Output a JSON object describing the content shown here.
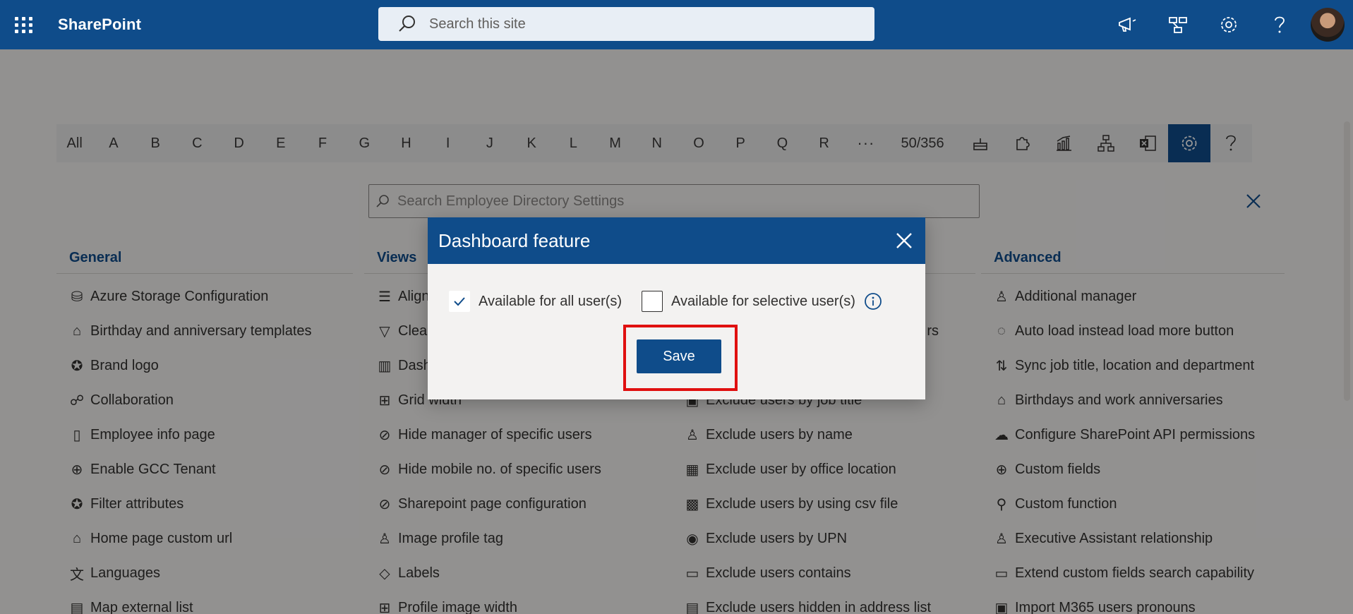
{
  "app": {
    "brand": "SharePoint",
    "search_placeholder": "Search this site"
  },
  "alphabet": {
    "items": [
      "All",
      "A",
      "B",
      "C",
      "D",
      "E",
      "F",
      "G",
      "H",
      "I",
      "J",
      "K",
      "L",
      "M",
      "N",
      "O",
      "P",
      "Q",
      "R"
    ],
    "more": "···",
    "count": "50/356"
  },
  "settings_search": {
    "placeholder": "Search Employee Directory Settings"
  },
  "columns": {
    "general": {
      "title": "General",
      "items": [
        {
          "label": "Azure Storage Configuration",
          "icon": "database-icon"
        },
        {
          "label": "Birthday and anniversary templates",
          "icon": "cake-icon"
        },
        {
          "label": "Brand logo",
          "icon": "badge-icon"
        },
        {
          "label": "Collaboration",
          "icon": "handshake-icon"
        },
        {
          "label": "Employee info page",
          "icon": "page-search-icon"
        },
        {
          "label": "Enable GCC Tenant",
          "icon": "globe-icon"
        },
        {
          "label": "Filter attributes",
          "icon": "badge-icon"
        },
        {
          "label": "Home page custom url",
          "icon": "home-icon"
        },
        {
          "label": "Languages",
          "icon": "language-icon"
        },
        {
          "label": "Map external list",
          "icon": "list-icon"
        }
      ]
    },
    "views": {
      "title": "Views",
      "items": [
        {
          "label": "Align",
          "icon": "align-icon"
        },
        {
          "label": "Clear",
          "icon": "filter-icon"
        },
        {
          "label": "Dash",
          "icon": "chart-icon"
        },
        {
          "label": "Grid width",
          "icon": "grid-icon"
        },
        {
          "label": "Hide manager of specific users",
          "icon": "hide-icon"
        },
        {
          "label": "Hide mobile no. of specific users",
          "icon": "hide-icon"
        },
        {
          "label": "Sharepoint page configuration",
          "icon": "hide-icon"
        },
        {
          "label": "Image profile tag",
          "icon": "person-icon"
        },
        {
          "label": "Labels",
          "icon": "tag-icon"
        },
        {
          "label": "Profile image width",
          "icon": "grid-icon"
        }
      ]
    },
    "exclude": {
      "items": [
        {
          "label": "",
          "icon": ""
        },
        {
          "label": "rs",
          "icon": ""
        },
        {
          "label": "",
          "icon": ""
        },
        {
          "label": "Exclude users by job title",
          "icon": "briefcase-icon"
        },
        {
          "label": "Exclude users by name",
          "icon": "person-search-icon"
        },
        {
          "label": "Exclude user by office location",
          "icon": "building-icon"
        },
        {
          "label": "Exclude users by using csv file",
          "icon": "excel-icon"
        },
        {
          "label": "Exclude users by UPN",
          "icon": "signal-icon"
        },
        {
          "label": "Exclude users contains",
          "icon": "folder-search-icon"
        },
        {
          "label": "Exclude users hidden in address list",
          "icon": "list-icon"
        }
      ]
    },
    "advanced": {
      "title": "Advanced",
      "items": [
        {
          "label": "Additional manager",
          "icon": "people-icon"
        },
        {
          "label": "Auto load instead load more button",
          "icon": "spinner-icon"
        },
        {
          "label": "Sync job title, location and department",
          "icon": "sort-icon"
        },
        {
          "label": "Birthdays and work anniversaries",
          "icon": "cake-icon"
        },
        {
          "label": "Configure SharePoint API permissions",
          "icon": "cloud-icon"
        },
        {
          "label": "Custom fields",
          "icon": "add-circle-icon"
        },
        {
          "label": "Custom function",
          "icon": "search-icon"
        },
        {
          "label": "Executive Assistant relationship",
          "icon": "people-icon"
        },
        {
          "label": "Extend custom fields search capability",
          "icon": "screen-icon"
        },
        {
          "label": "Import M365 users pronouns",
          "icon": "contact-icon"
        }
      ]
    }
  },
  "dialog": {
    "title": "Dashboard feature",
    "option_all": "Available for all user(s)",
    "option_all_checked": true,
    "option_selective": "Available for selective user(s)",
    "option_selective_checked": false,
    "save_label": "Save"
  }
}
